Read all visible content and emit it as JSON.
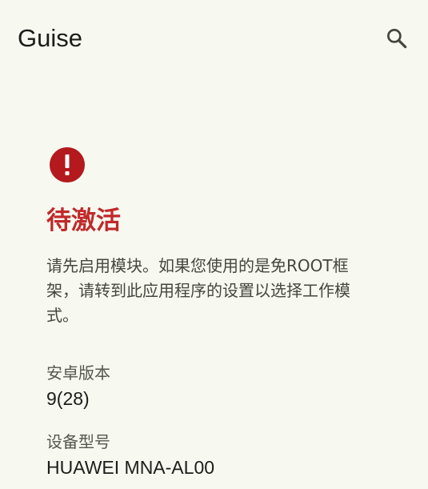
{
  "appbar": {
    "title": "Guise",
    "search_icon": "search-icon"
  },
  "status": {
    "icon": "error-icon",
    "icon_color": "#b3191d",
    "title": "待激活",
    "title_color": "#c0292a",
    "description": "请先启用模块。如果您使用的是免ROOT框架，请转到此应用程序的设置以选择工作模式。"
  },
  "info": [
    {
      "label": "安卓版本",
      "value": "9(28)"
    },
    {
      "label": "设备型号",
      "value": "HUAWEI MNA-AL00"
    }
  ]
}
